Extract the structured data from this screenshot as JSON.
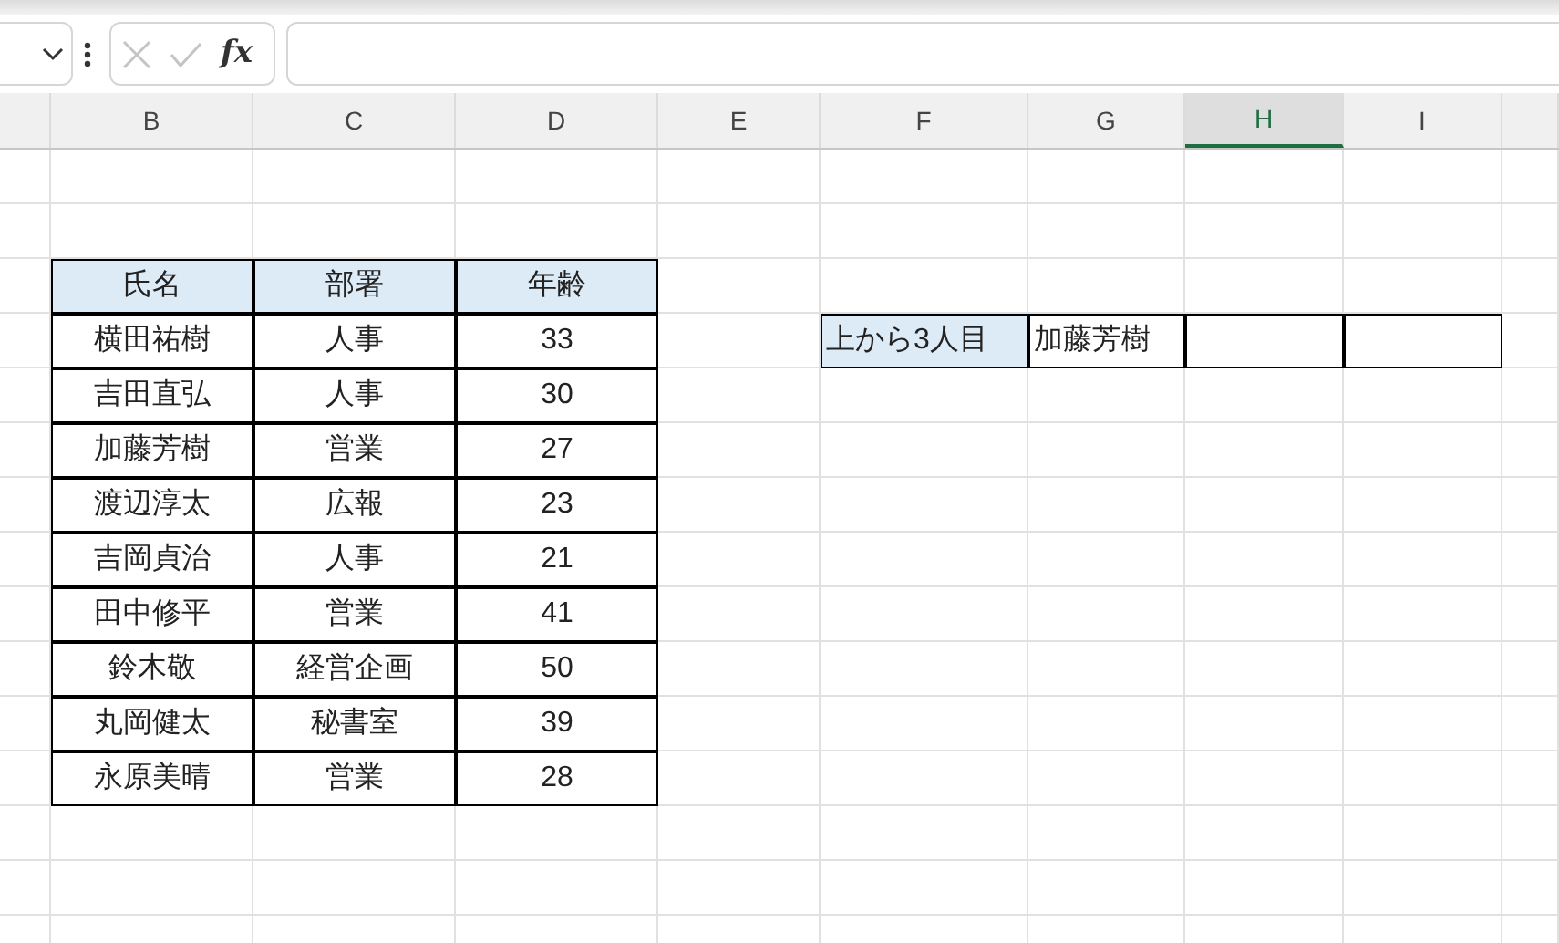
{
  "formula_bar": {
    "function_symbol": "fx"
  },
  "column_headers": [
    {
      "label": "B",
      "selected": false
    },
    {
      "label": "C",
      "selected": false
    },
    {
      "label": "D",
      "selected": false
    },
    {
      "label": "E",
      "selected": false
    },
    {
      "label": "F",
      "selected": false
    },
    {
      "label": "G",
      "selected": false
    },
    {
      "label": "H",
      "selected": true
    },
    {
      "label": "I",
      "selected": false
    }
  ],
  "table": {
    "columns": [
      "氏名",
      "部署",
      "年齢"
    ],
    "rows": [
      [
        "横田祐樹",
        "人事",
        "33"
      ],
      [
        "吉田直弘",
        "人事",
        "30"
      ],
      [
        "加藤芳樹",
        "営業",
        "27"
      ],
      [
        "渡辺淳太",
        "広報",
        "23"
      ],
      [
        "吉岡貞治",
        "人事",
        "21"
      ],
      [
        "田中修平",
        "営業",
        "41"
      ],
      [
        "鈴木敬",
        "経営企画",
        "50"
      ],
      [
        "丸岡健太",
        "秘書室",
        "39"
      ],
      [
        "永原美晴",
        "営業",
        "28"
      ]
    ]
  },
  "lookup": {
    "label": "上から3人目",
    "value": "加藤芳樹"
  }
}
